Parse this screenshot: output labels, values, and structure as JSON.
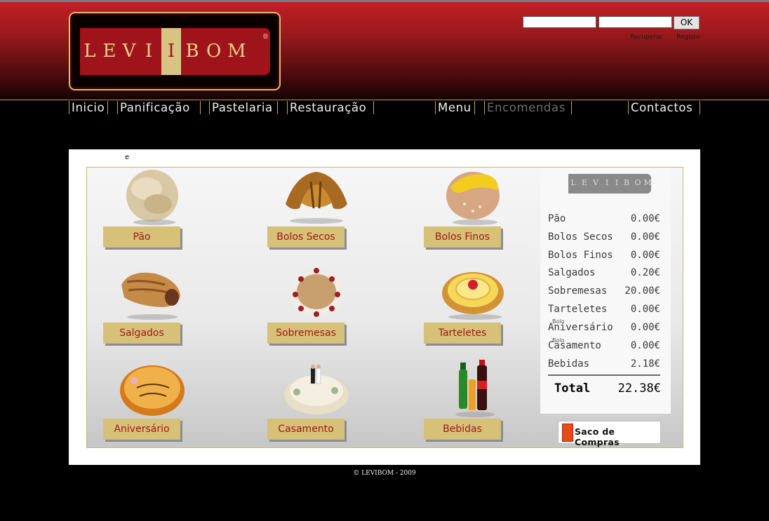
{
  "header": {
    "logo_text": "LEVIBOM",
    "login": {
      "ok_label": "OK",
      "recover_label": "Recuperar",
      "register_label": "Registo"
    }
  },
  "nav": {
    "items": [
      "Inicio",
      "Panificação",
      "Pastelaria",
      "Restauração",
      "Menu",
      "Encomendas",
      "Contactos"
    ],
    "active": "Encomendas"
  },
  "content": {
    "stray_char": "e",
    "categories": [
      "Pão",
      "Bolos Secos",
      "Bolos Finos",
      "Salgados",
      "Sobremesas",
      "Tarteletes",
      "Aniversário",
      "Casamento",
      "Bebidas"
    ]
  },
  "receipt": {
    "logo_text": "LEVIBOM",
    "items": [
      {
        "name": "Pão",
        "value": "0.00€"
      },
      {
        "name": "Bolos Secos",
        "value": "0.00€"
      },
      {
        "name": "Bolos Finos",
        "value": "0.00€"
      },
      {
        "name": "Salgados",
        "value": "0.20€"
      },
      {
        "name": "Sobremesas",
        "value": "20.00€"
      },
      {
        "name": "Tarteletes",
        "value": "0.00€"
      },
      {
        "name": "Aniversário",
        "value": "0.00€",
        "prefix": "Bolo"
      },
      {
        "name": "Casamento",
        "value": "0.00€",
        "prefix": "Bolo"
      },
      {
        "name": "Bebidas",
        "value": "2.18€"
      }
    ],
    "total_label": "Total",
    "total_value": "22.38€",
    "cart_label": "Saco de Compras"
  },
  "footer": {
    "copyright": "© LEVIBOM - 2009"
  },
  "colors": {
    "brand_red": "#9f141b",
    "gold": "#d8c383",
    "button_text": "#a11718"
  }
}
